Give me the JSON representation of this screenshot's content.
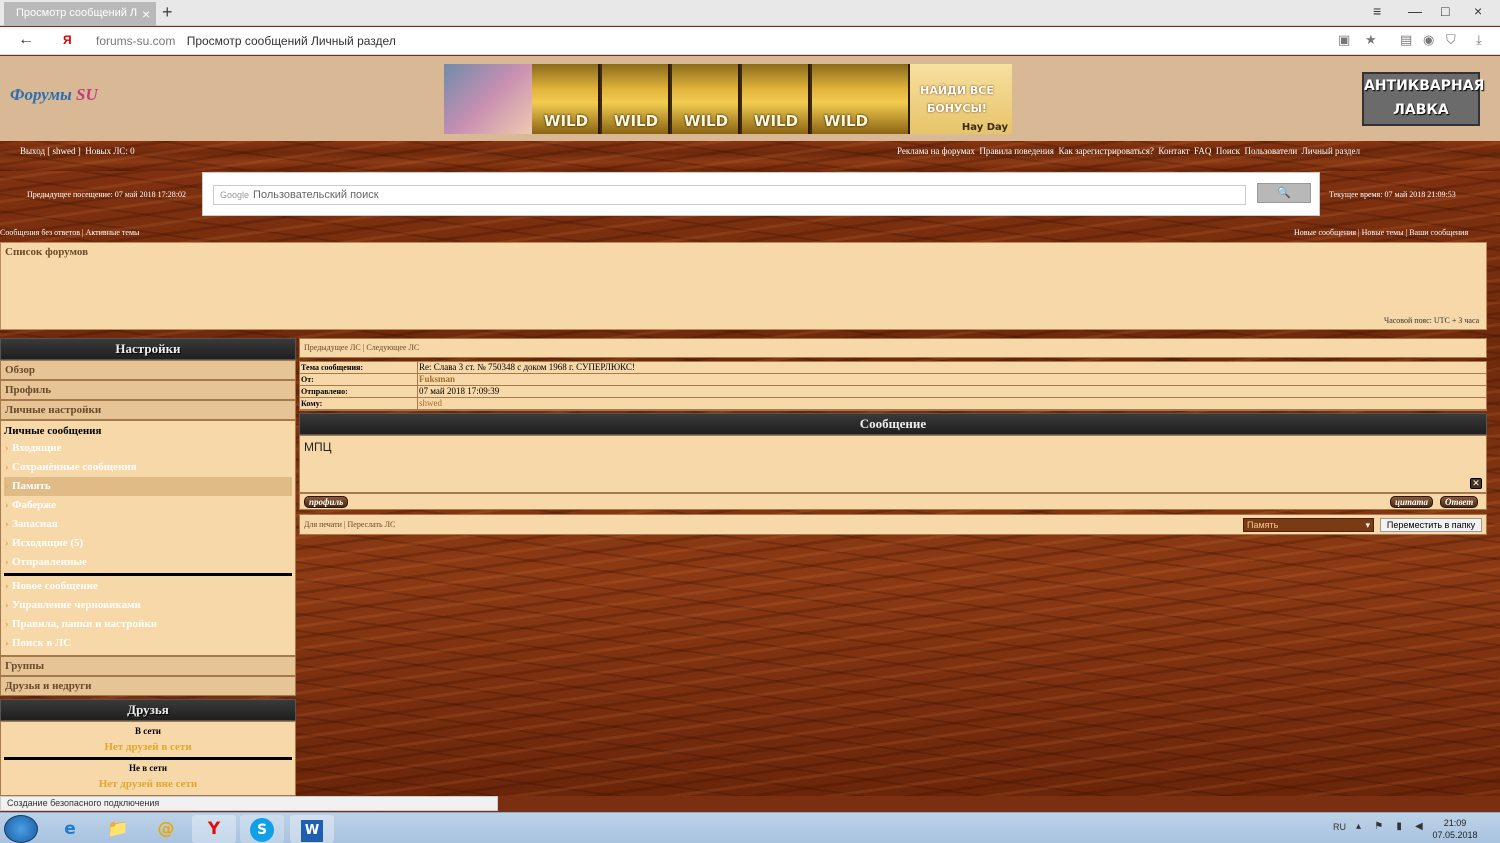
{
  "browser": {
    "tab_title": "Просмотр сообщений Л",
    "tab_close": "×",
    "new_tab": "+",
    "window_controls": [
      "≡",
      "—",
      "□",
      "×"
    ],
    "url_domain": "forums-su.com",
    "url_title": "Просмотр сообщений Личный раздел",
    "icons": [
      "back-arrow-icon",
      "lock-icon",
      "star-icon",
      "download-icon"
    ]
  },
  "header": {
    "logo_part1": "Форумы",
    "logo_part2": "SU",
    "banner_slot": "WILD",
    "banner_bonus": "НАЙДИ ВСЕ БОНУСЫ!",
    "banner_game": "Hay Day",
    "antik": "АНТИКВАРНАЯ ЛАВКА"
  },
  "topnav": {
    "left": [
      "Выход [ shwed ]",
      "Новых ЛС: 0"
    ],
    "right": [
      "Реклама на форумах",
      "Правила поведения",
      "Как зарегистрироваться?",
      "Контакт",
      "FAQ",
      "Поиск",
      "Пользователи",
      "Личный раздел"
    ]
  },
  "visits": {
    "previous": "Предыдущее посещение: 07 май 2018 17:28:02",
    "current": "Текущее время: 07 май 2018 21:09:53"
  },
  "search": {
    "brand": "Google",
    "placeholder": "Пользовательский поиск",
    "button": "🔍"
  },
  "links": {
    "left": "Сообщения без ответов | Активные темы",
    "right": "Новые сообщения | Новые темы | Ваши сообщения"
  },
  "forumlist": {
    "title": "Список форумов",
    "timezone": "Часовой пояс: UTC + 3 часа"
  },
  "sidebar": {
    "settings_title": "Настройки",
    "tabs": [
      "Обзор",
      "Профиль",
      "Личные настройки"
    ],
    "pm_title": "Личные сообщения",
    "pm_items": [
      "Входящие",
      "Сохранённые сообщения",
      "Память",
      "Фаберже",
      "Запасная",
      "Исходящие (5)",
      "Отправленные"
    ],
    "pm_selected_index": 2,
    "pm_tools": [
      "Новое сообщение",
      "Управление черновиками",
      "Правила, папки и настройки",
      "Поиск в ЛС"
    ],
    "tabs_bottom": [
      "Группы",
      "Друзья и недруги"
    ],
    "friends_title": "Друзья",
    "online_label": "В сети",
    "online_none": "Нет друзей в сети",
    "offline_label": "Не в сети",
    "offline_none": "Нет друзей вне сети"
  },
  "message": {
    "nav": "Предыдущее ЛС | Следующее ЛС",
    "fields": [
      {
        "key": "Тема сообщения:",
        "value": "Re: Слава 3 ст. № 750348 с доком 1968 г. СУПЕРЛЮКС!"
      },
      {
        "key": "От:",
        "value": "Fuksman"
      },
      {
        "key": "Отправлено:",
        "value": "07 май 2018 17:09:39"
      },
      {
        "key": "Кому:",
        "value": "shwed"
      }
    ],
    "section_title": "Сообщение",
    "text": "МПЦ",
    "profile_btn": "профиль",
    "quote_btn": "цитата",
    "reply_btn": "Ответ",
    "bottom_left": "Для печати | Переслать ЛС",
    "folder_select": "Память",
    "move_btn": "Переместить в папку"
  },
  "status": "Создание безопасного подключения",
  "taskbar": {
    "apps": [
      "e",
      "📁",
      "@",
      "Y",
      "S",
      "W"
    ],
    "lang": "RU",
    "tray": "▴ ⚑ ▮ ◀",
    "time": "21:09",
    "date": "07.05.2018"
  }
}
